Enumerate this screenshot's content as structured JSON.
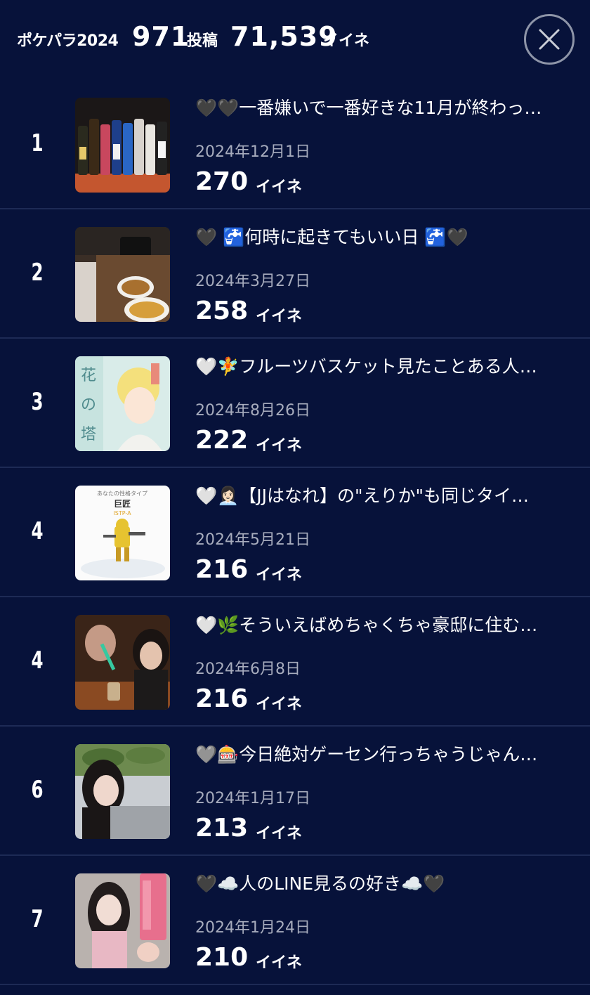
{
  "header": {
    "title": "ポケパラ2024",
    "posts_count": "971",
    "posts_label": "投稿",
    "likes_count": "71,539",
    "likes_label": "イイネ"
  },
  "icons": {
    "close": "close-icon"
  },
  "colors": {
    "background": "#07123a",
    "divider": "#1d2a55",
    "date": "#a7acbd",
    "close_ring": "#8e95a8"
  },
  "ranking": [
    {
      "rank": "1",
      "title": "🖤🖤一番嫌いで一番好きな11月が終わっ…",
      "date": "2024年12月1日",
      "likes": "270",
      "likes_label": "イイネ"
    },
    {
      "rank": "2",
      "title": "🖤 🚰何時に起きてもいい日 🚰🖤",
      "date": "2024年3月27日",
      "likes": "258",
      "likes_label": "イイネ"
    },
    {
      "rank": "3",
      "title": "🤍🧚フルーツバスケット見たことある人…",
      "date": "2024年8月26日",
      "likes": "222",
      "likes_label": "イイネ"
    },
    {
      "rank": "4",
      "title": "🤍👩🏻‍💼【JJはなれ】の\"えりか\"も同じタイ…",
      "date": "2024年5月21日",
      "likes": "216",
      "likes_label": "イイネ"
    },
    {
      "rank": "4",
      "title": "🤍🌿そういえばめちゃくちゃ豪邸に住む…",
      "date": "2024年6月8日",
      "likes": "216",
      "likes_label": "イイネ"
    },
    {
      "rank": "6",
      "title": "🩶🎰今日絶対ゲーセン行っちゃうじゃん…",
      "date": "2024年1月17日",
      "likes": "213",
      "likes_label": "イイネ"
    },
    {
      "rank": "7",
      "title": "🖤☁️人のLINE見るの好き☁️🖤",
      "date": "2024年1月24日",
      "likes": "210",
      "likes_label": "イイネ"
    }
  ],
  "thumbnails": {
    "4": {
      "heading": "あなたの性格タイプ",
      "type_name": "巨匠",
      "type_code": "ISTP-A"
    },
    "3": {
      "cover_text": "花の塔"
    }
  }
}
